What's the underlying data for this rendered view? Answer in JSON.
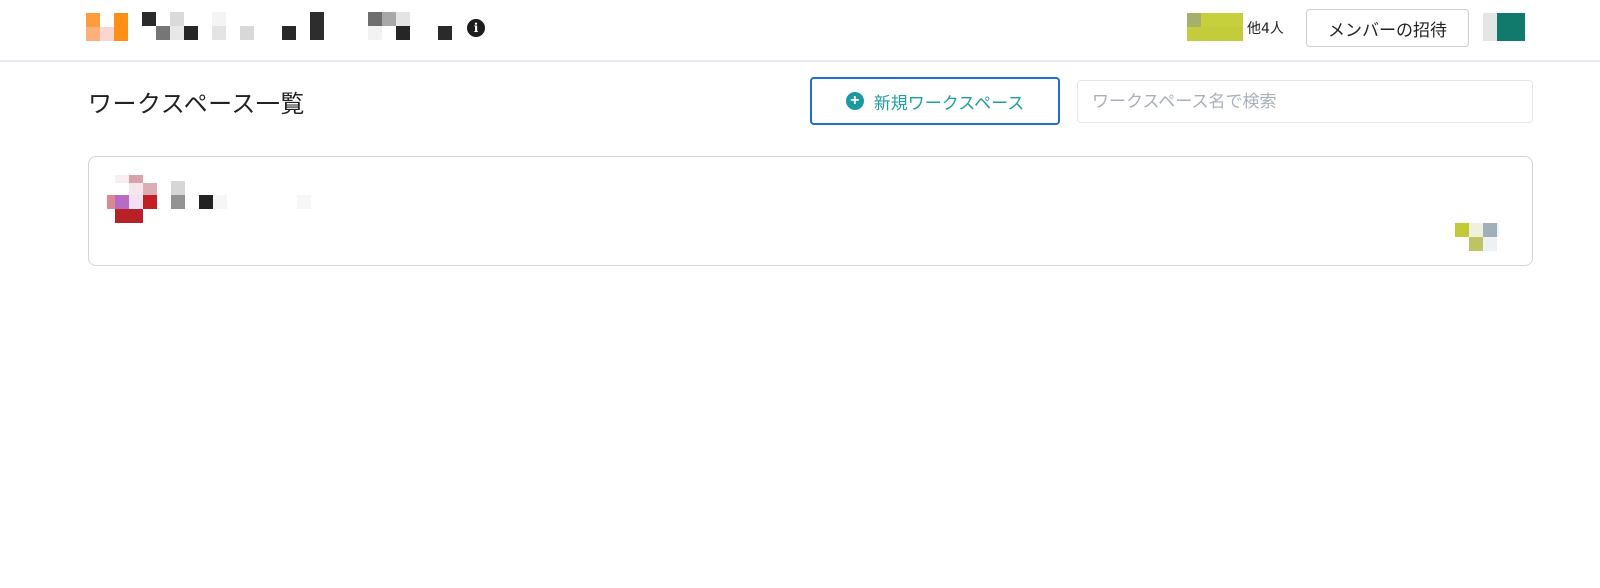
{
  "header": {
    "org_logo_icon": "organization-logo-icon",
    "info_icon_glyph": "i",
    "others_count": "他4人",
    "invite_button_label": "メンバーの招待",
    "user_avatar_icon": "user-avatar-icon"
  },
  "toolbar": {
    "page_title": "ワークスペース一覧",
    "new_workspace_label": "新規ワークスペース",
    "new_workspace_icon": "plus-circle-icon",
    "plus_glyph": "+",
    "search_placeholder": "ワークスペース名で検索",
    "search_value": ""
  },
  "workspaces": [
    {
      "icon": "workspace-icon",
      "members_icon": "workspace-members-icon"
    }
  ],
  "colors": {
    "accent_teal": "#1a9aa0",
    "button_border_blue": "#1e6fd0",
    "header_border": "#e6ebf1",
    "card_border": "#cfd5dd"
  }
}
